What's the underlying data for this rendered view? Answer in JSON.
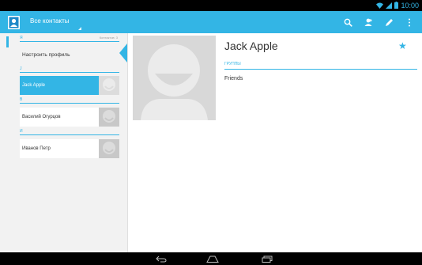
{
  "status_bar": {
    "time": "10:00",
    "icons": [
      "wifi-icon",
      "signal-icon",
      "battery-icon"
    ]
  },
  "action_bar": {
    "title": "Все контакты",
    "actions": [
      "search-icon",
      "add-contact-icon",
      "edit-icon",
      "overflow-menu-icon"
    ]
  },
  "contact_list": {
    "sections": [
      {
        "letter": "Я",
        "count_label": "Контактов: 3"
      },
      {
        "letter": "J"
      },
      {
        "letter": "В"
      },
      {
        "letter": "И"
      }
    ],
    "profile_label": "Настроить профиль",
    "items": [
      {
        "name": "Jack Apple",
        "selected": true
      },
      {
        "name": "Василий Огурцов",
        "selected": false
      },
      {
        "name": "Иванов Петр",
        "selected": false
      }
    ]
  },
  "detail": {
    "name": "Jack Apple",
    "groups_header": "ГРУППЫ",
    "groups_value": "Friends",
    "starred": true
  },
  "nav_bar": [
    "back-icon",
    "home-icon",
    "recent-apps-icon"
  ],
  "colors": {
    "accent": "#33b5e5",
    "list_bg": "#f2f2f2",
    "detail_bg": "#ffffff",
    "photo_placeholder": "#d8d8d8"
  }
}
